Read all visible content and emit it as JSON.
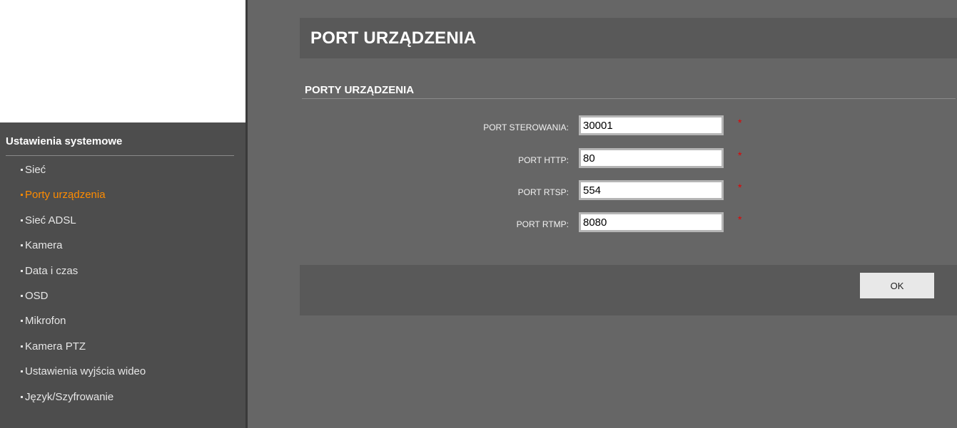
{
  "sidebar": {
    "title": "Ustawienia systemowe",
    "items": [
      {
        "label": "Sieć",
        "active": false
      },
      {
        "label": "Porty urządzenia",
        "active": true
      },
      {
        "label": "Sieć ADSL",
        "active": false
      },
      {
        "label": "Kamera",
        "active": false
      },
      {
        "label": "Data i czas",
        "active": false
      },
      {
        "label": "OSD",
        "active": false
      },
      {
        "label": "Mikrofon",
        "active": false
      },
      {
        "label": "Kamera PTZ",
        "active": false
      },
      {
        "label": "Ustawienia wyjścia wideo",
        "active": false
      },
      {
        "label": "Język/Szyfrowanie",
        "active": false
      }
    ]
  },
  "panel": {
    "title": "PORT URZĄDZENIA",
    "section_title": "PORTY URZĄDZENIA"
  },
  "form": {
    "fields": [
      {
        "label": "PORT STEROWANIA:",
        "value": "30001",
        "required_mark": "*"
      },
      {
        "label": "PORT HTTP:",
        "value": "80",
        "required_mark": "*"
      },
      {
        "label": "PORT RTSP:",
        "value": "554",
        "required_mark": "*"
      },
      {
        "label": "PORT RTMP:",
        "value": "8080",
        "required_mark": "*"
      }
    ]
  },
  "footer": {
    "ok_label": "OK"
  },
  "colors": {
    "sidebar_bg": "#4d4d4d",
    "main_bg": "#666666",
    "panel_bg": "#595959",
    "active_item": "#ff8c00",
    "required_star": "#e60000"
  }
}
